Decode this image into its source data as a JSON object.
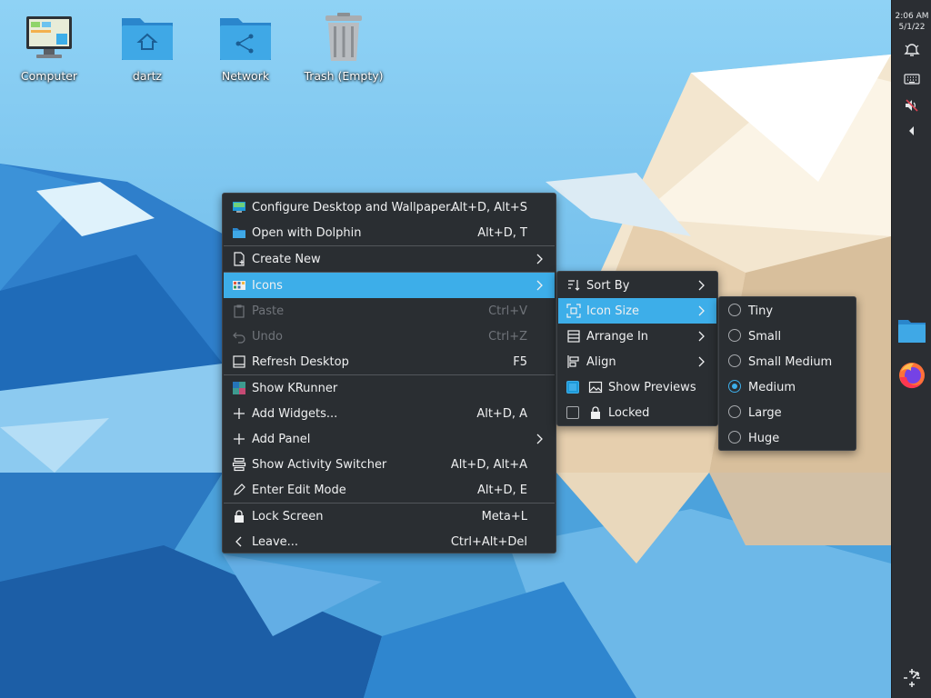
{
  "desktop": {
    "icons": [
      {
        "label": "Computer",
        "icon": "computer-icon"
      },
      {
        "label": "dartz",
        "icon": "home-folder-icon"
      },
      {
        "label": "Network",
        "icon": "network-folder-icon"
      },
      {
        "label": "Trash (Empty)",
        "icon": "trash-icon"
      }
    ]
  },
  "panel": {
    "clock": {
      "time": "2:06 AM",
      "date": "5/1/22"
    },
    "tray": [
      "notifications-icon",
      "keyboard-icon",
      "volume-muted-icon",
      "expand-tray-icon"
    ],
    "tasks": [
      "dolphin-icon",
      "firefox-icon"
    ],
    "options_icon": "panel-options-icon"
  },
  "context_menu": {
    "items": [
      {
        "label": "Configure Desktop and Wallpaper...",
        "shortcut": "Alt+D, Alt+S",
        "icon": "configure-desktop-icon"
      },
      {
        "label": "Open with Dolphin",
        "shortcut": "Alt+D, T",
        "icon": "folder-icon"
      },
      {
        "label": "Create New",
        "icon": "new-document-icon"
      },
      {
        "label": "Icons",
        "icon": "icons-view-icon"
      },
      {
        "label": "Paste",
        "shortcut": "Ctrl+V",
        "icon": "paste-icon"
      },
      {
        "label": "Undo",
        "shortcut": "Ctrl+Z",
        "icon": "undo-icon"
      },
      {
        "label": "Refresh Desktop",
        "shortcut": "F5",
        "icon": "refresh-icon"
      },
      {
        "label": "Show KRunner",
        "icon": "krunner-icon"
      },
      {
        "label": "Add Widgets...",
        "shortcut": "Alt+D, A",
        "icon": "plus-icon"
      },
      {
        "label": "Add Panel",
        "icon": "plus-icon"
      },
      {
        "label": "Show Activity Switcher",
        "shortcut": "Alt+D, Alt+A",
        "icon": "activities-icon"
      },
      {
        "label": "Enter Edit Mode",
        "shortcut": "Alt+D, E",
        "icon": "edit-icon"
      },
      {
        "label": "Lock Screen",
        "shortcut": "Meta+L",
        "icon": "lock-icon"
      },
      {
        "label": "Leave...",
        "shortcut": "Ctrl+Alt+Del",
        "icon": "chevron-left-icon"
      }
    ]
  },
  "icons_menu": {
    "items": [
      {
        "label": "Sort By",
        "icon": "sort-icon"
      },
      {
        "label": "Icon Size",
        "icon": "icon-size-icon"
      },
      {
        "label": "Arrange In",
        "icon": "arrange-icon"
      },
      {
        "label": "Align",
        "icon": "align-icon"
      },
      {
        "label": "Show Previews",
        "icon": "image-icon",
        "checked": true
      },
      {
        "label": "Locked",
        "icon": "lock-icon",
        "checked": false
      }
    ]
  },
  "size_menu": {
    "selected": "Medium",
    "items": [
      {
        "label": "Tiny"
      },
      {
        "label": "Small"
      },
      {
        "label": "Small Medium"
      },
      {
        "label": "Medium"
      },
      {
        "label": "Large"
      },
      {
        "label": "Huge"
      }
    ]
  },
  "colors": {
    "accent": "#3daee9",
    "menu_bg": "#2a2e32",
    "panel_bg": "#2b2e33"
  }
}
